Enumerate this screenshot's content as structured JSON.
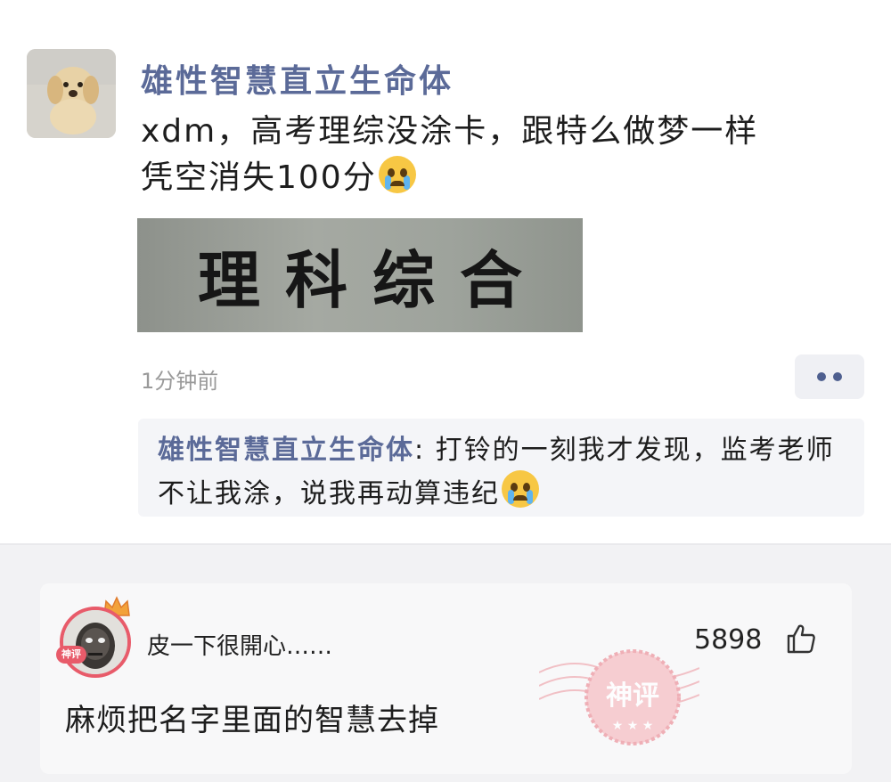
{
  "post": {
    "author": "雄性智慧直立生命体",
    "text_line1": "xdm，高考理综没涂卡，跟特么做梦一样",
    "text_line2": "凭空消失100分",
    "image_text": "理科综合",
    "timestamp": "1分钟前"
  },
  "reply": {
    "author": "雄性智慧直立生命体",
    "separator": ":",
    "text": " 打铃的一刻我才发现，监考老师不让我涂，说我再动算违纪"
  },
  "comment": {
    "username": "皮一下很開心……",
    "likes": "5898",
    "text": "麻烦把名字里面的智慧去掉",
    "badge": "神评",
    "avatar_badge": "神评"
  },
  "icons": {
    "emoji": "crying-emoji-icon",
    "more": "more-dots-icon",
    "like": "thumbs-up-icon",
    "crown": "crown-icon"
  },
  "colors": {
    "author": "#5b6a98",
    "accent": "#e85b6a"
  }
}
